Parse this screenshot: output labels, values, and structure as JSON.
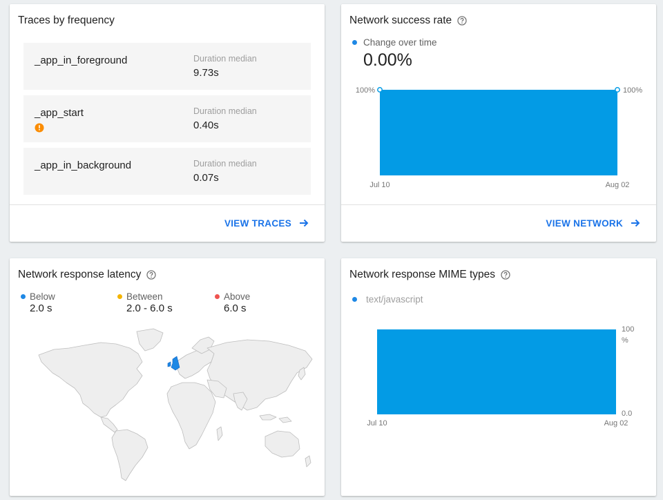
{
  "traces_card": {
    "title": "Traces by frequency",
    "items": [
      {
        "name": "_app_in_foreground",
        "metric_label": "Duration median",
        "metric_value": "9.73s",
        "warning": false
      },
      {
        "name": "_app_start",
        "metric_label": "Duration median",
        "metric_value": "0.40s",
        "warning": true
      },
      {
        "name": "_app_in_background",
        "metric_label": "Duration median",
        "metric_value": "0.07s",
        "warning": false
      }
    ],
    "action_label": "VIEW TRACES"
  },
  "success_card": {
    "title": "Network success rate",
    "legend_label": "Change over time",
    "value": "0.00%",
    "action_label": "VIEW NETWORK"
  },
  "latency_card": {
    "title": "Network response latency",
    "legend": [
      {
        "label": "Below",
        "value": "2.0 s",
        "color": "#1e88e5"
      },
      {
        "label": "Between",
        "value": "2.0 - 6.0 s",
        "color": "#f4b400"
      },
      {
        "label": "Above",
        "value": "6.0 s",
        "color": "#ef5350"
      }
    ]
  },
  "mime_card": {
    "title": "Network response MIME types",
    "legend_label": "text/javascript"
  },
  "chart_data": [
    {
      "type": "area",
      "x": [
        "Jul 10",
        "Aug 02"
      ],
      "series": [
        {
          "values": [
            100,
            100
          ],
          "color": "#039be5"
        }
      ],
      "start_value_label": "100%",
      "end_value_label": "100%",
      "ylim": [
        0,
        100
      ]
    },
    {
      "type": "bar",
      "x": [
        "Jul 10",
        "Aug 02"
      ],
      "series": [
        {
          "name": "text/javascript",
          "values": [
            100
          ],
          "color": "#039be5"
        }
      ],
      "y_max_label": "100",
      "y_unit_label": "%",
      "y_min_label": "0.0",
      "ylim": [
        0,
        100
      ]
    }
  ],
  "colors": {
    "accent": "#1a73e8",
    "chart_fill": "#039be5",
    "warning": "#fb8c00"
  }
}
